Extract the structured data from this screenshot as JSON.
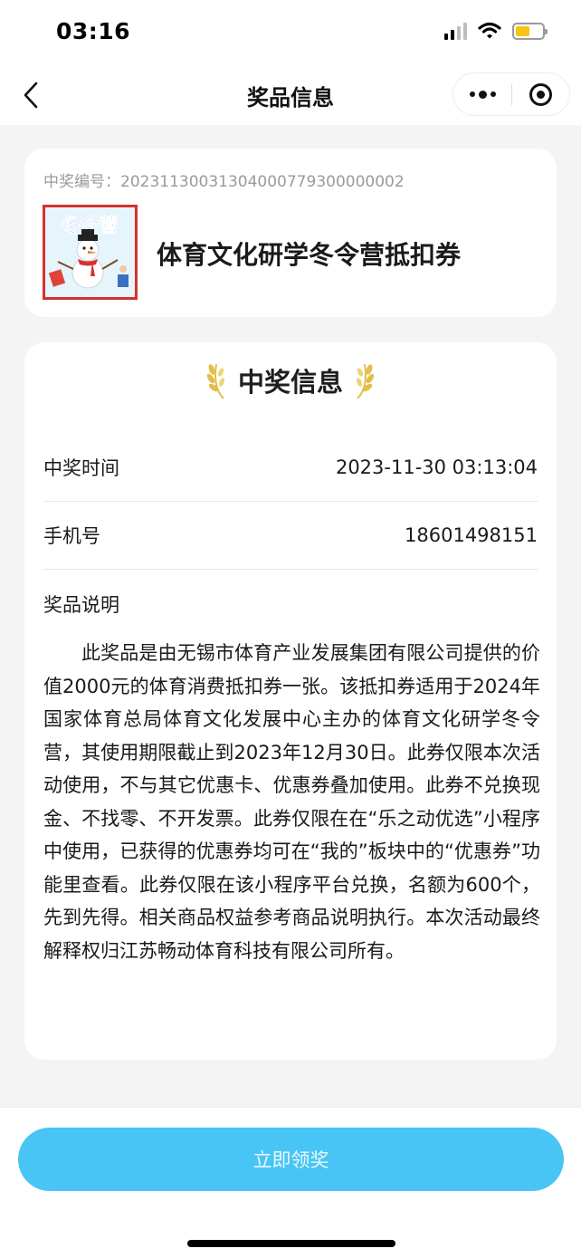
{
  "status_bar": {
    "time": "03:16",
    "battery_level": 0.55,
    "battery_color": "#f5c518"
  },
  "nav": {
    "title": "奖品信息",
    "back_icon": "chevron-left-icon",
    "more_icon": "more-dots-icon",
    "close_icon": "target-circle-icon"
  },
  "prize": {
    "number_label": "中奖编号：",
    "number": "20231130031304000779300000002",
    "image_text": "冬令营",
    "title": "体育文化研学冬令营抵扣券"
  },
  "info": {
    "heading": "中奖信息",
    "rows": [
      {
        "label": "中奖时间",
        "value": "2023-11-30 03:13:04"
      },
      {
        "label": "手机号",
        "value": "18601498151"
      }
    ],
    "desc_label": "奖品说明",
    "description": "此奖品是由无锡市体育产业发展集团有限公司提供的价值2000元的体育消费抵扣券一张。该抵扣券适用于2024年国家体育总局体育文化发展中心主办的体育文化研学冬令营，其使用期限截止到2023年12月30日。此券仅限本次活动使用，不与其它优惠卡、优惠券叠加使用。此券不兑换现金、不找零、不开发票。此券仅限在在“乐之动优选”小程序中使用，已获得的优惠券均可在“我的”板块中的“优惠券”功能里查看。此券仅限在该小程序平台兑换，名额为600个，先到先得。相关商品权益参考商品说明执行。本次活动最终解释权归江苏畅动体育科技有限公司所有。"
  },
  "footer": {
    "claim_label": "立即领奖",
    "accent": "#48c5f4"
  }
}
